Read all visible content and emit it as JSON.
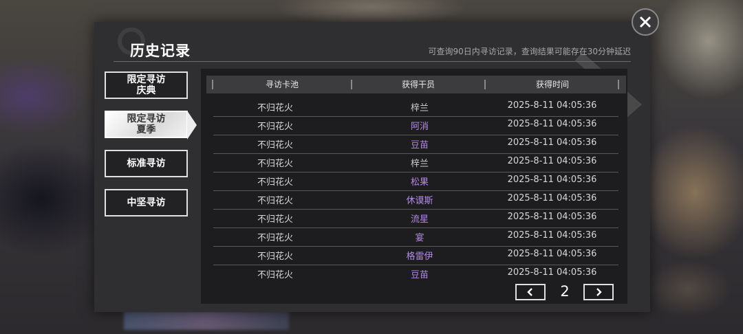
{
  "dialog": {
    "title": "历史记录",
    "subtitle": "可查询90日内寻访记录，查询结果可能存在30分钟延迟"
  },
  "tabs": [
    {
      "label": "限定寻访\n庆典",
      "active": false
    },
    {
      "label": "限定寻访\n夏季",
      "active": true
    },
    {
      "label": "标准寻访",
      "active": false
    },
    {
      "label": "中坚寻访",
      "active": false
    }
  ],
  "table": {
    "headers": [
      "寻访卡池",
      "获得干员",
      "获得时间"
    ],
    "rows": [
      {
        "pool": "不归花火",
        "operator": "梓兰",
        "rarity": "normal",
        "time": "2025-8-11 04:05:36"
      },
      {
        "pool": "不归花火",
        "operator": "阿消",
        "rarity": "rare",
        "time": "2025-8-11 04:05:36"
      },
      {
        "pool": "不归花火",
        "operator": "豆苗",
        "rarity": "rare",
        "time": "2025-8-11 04:05:36"
      },
      {
        "pool": "不归花火",
        "operator": "梓兰",
        "rarity": "normal",
        "time": "2025-8-11 04:05:36"
      },
      {
        "pool": "不归花火",
        "operator": "松果",
        "rarity": "rare",
        "time": "2025-8-11 04:05:36"
      },
      {
        "pool": "不归花火",
        "operator": "休谟斯",
        "rarity": "rare",
        "time": "2025-8-11 04:05:36"
      },
      {
        "pool": "不归花火",
        "operator": "流星",
        "rarity": "rare",
        "time": "2025-8-11 04:05:36"
      },
      {
        "pool": "不归花火",
        "operator": "宴",
        "rarity": "rare",
        "time": "2025-8-11 04:05:36"
      },
      {
        "pool": "不归花火",
        "operator": "格雷伊",
        "rarity": "rare",
        "time": "2025-8-11 04:05:36"
      },
      {
        "pool": "不归花火",
        "operator": "豆苗",
        "rarity": "rare",
        "time": "2025-8-11 04:05:36"
      }
    ]
  },
  "pager": {
    "page": "2"
  },
  "colors": {
    "rare_operator": "#b48ae6",
    "normal_operator": "#cfcfcf",
    "panel": "#1d1d1f"
  },
  "icons": {
    "close": "close-icon",
    "prev": "chevron-left-icon",
    "next": "chevron-right-icon"
  }
}
